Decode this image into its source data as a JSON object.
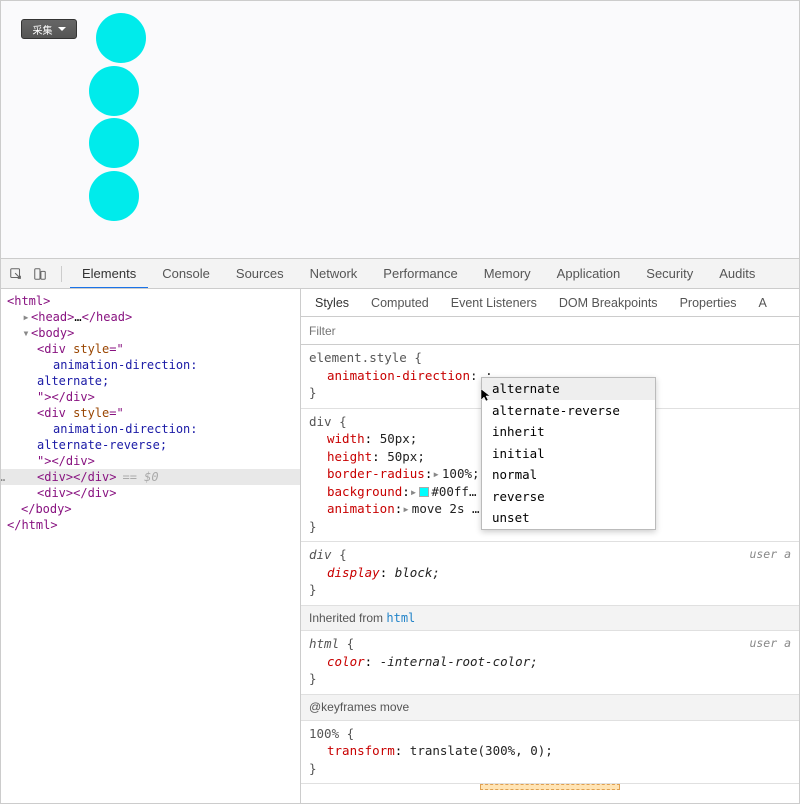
{
  "page": {
    "collect_label": "采集",
    "circle_color": "#00ebeb",
    "circle_size_px": 50
  },
  "devtools": {
    "tabs": [
      "Elements",
      "Console",
      "Sources",
      "Network",
      "Performance",
      "Memory",
      "Application",
      "Security",
      "Audits"
    ],
    "active_tab": "Elements"
  },
  "elements_tree": {
    "lines": {
      "l0": "<html>",
      "l1_open": "<head>",
      "l1_ell": "…",
      "l1_close": "</head>",
      "l2_open": "<body>",
      "l3_open": "<div ",
      "l3_attr": "style",
      "l3_eq": "=\"",
      "l4": "animation-direction:",
      "l5": "alternate;",
      "l6_close": "\"></div>",
      "l7_open": "<div ",
      "l7_attr": "style",
      "l7_eq": "=\"",
      "l8": "animation-direction:",
      "l9": "alternate-reverse;",
      "l10_close": "\"></div>",
      "l11_sel_open": "<div>",
      "l11_sel_close": "</div>",
      "l11_eq0": "== $0",
      "l12_open": "<div>",
      "l12_close": "</div>",
      "l13": "</body>",
      "l14": "</html>"
    }
  },
  "styles": {
    "tabs": [
      "Styles",
      "Computed",
      "Event Listeners",
      "DOM Breakpoints",
      "Properties",
      "A"
    ],
    "active_tab": "Styles",
    "filter_placeholder": "Filter",
    "rules": {
      "r0": {
        "selector": "element.style",
        "props": [
          {
            "name": "animation-direction",
            "value": ";"
          }
        ]
      },
      "r1": {
        "selector": "div",
        "props": [
          {
            "name": "width",
            "value": "50px;"
          },
          {
            "name": "height",
            "value": "50px;"
          },
          {
            "name": "border-radius",
            "expand": true,
            "value": "100%;"
          },
          {
            "name": "background",
            "expand": true,
            "swatch": "#00ffff",
            "value": "#00ff…"
          },
          {
            "name": "animation",
            "expand": true,
            "value": "move 2s …"
          }
        ]
      },
      "r2": {
        "selector": "div",
        "ua": "user a",
        "props": [
          {
            "name": "display",
            "value": "block;"
          }
        ]
      },
      "inherit_label": "Inherited from ",
      "inherit_from": "html",
      "r3": {
        "selector": "html",
        "ua": "user a",
        "props": [
          {
            "name": "color",
            "value": "-internal-root-color;"
          }
        ]
      },
      "kf_label": "@keyframes move",
      "r4": {
        "selector": "100%",
        "props": [
          {
            "name": "transform",
            "value": "translate(300%, 0);"
          }
        ]
      }
    }
  },
  "autocomplete": {
    "items": [
      "alternate",
      "alternate-reverse",
      "inherit",
      "initial",
      "normal",
      "reverse",
      "unset"
    ],
    "selected": "alternate"
  }
}
